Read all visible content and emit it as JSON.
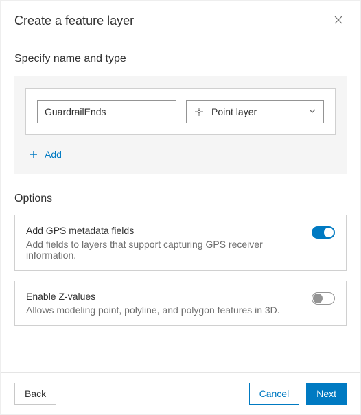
{
  "header": {
    "title": "Create a feature layer"
  },
  "section": {
    "name_and_type_title": "Specify name and type",
    "layer_name_value": "GuardrailEnds",
    "layer_type_label": "Point layer",
    "add_label": "Add"
  },
  "options": {
    "title": "Options",
    "gps": {
      "label": "Add GPS metadata fields",
      "desc": "Add fields to layers that support capturing GPS receiver information."
    },
    "z": {
      "label": "Enable Z-values",
      "desc": "Allows modeling point, polyline, and polygon features in 3D."
    }
  },
  "footer": {
    "back": "Back",
    "cancel": "Cancel",
    "next": "Next"
  }
}
